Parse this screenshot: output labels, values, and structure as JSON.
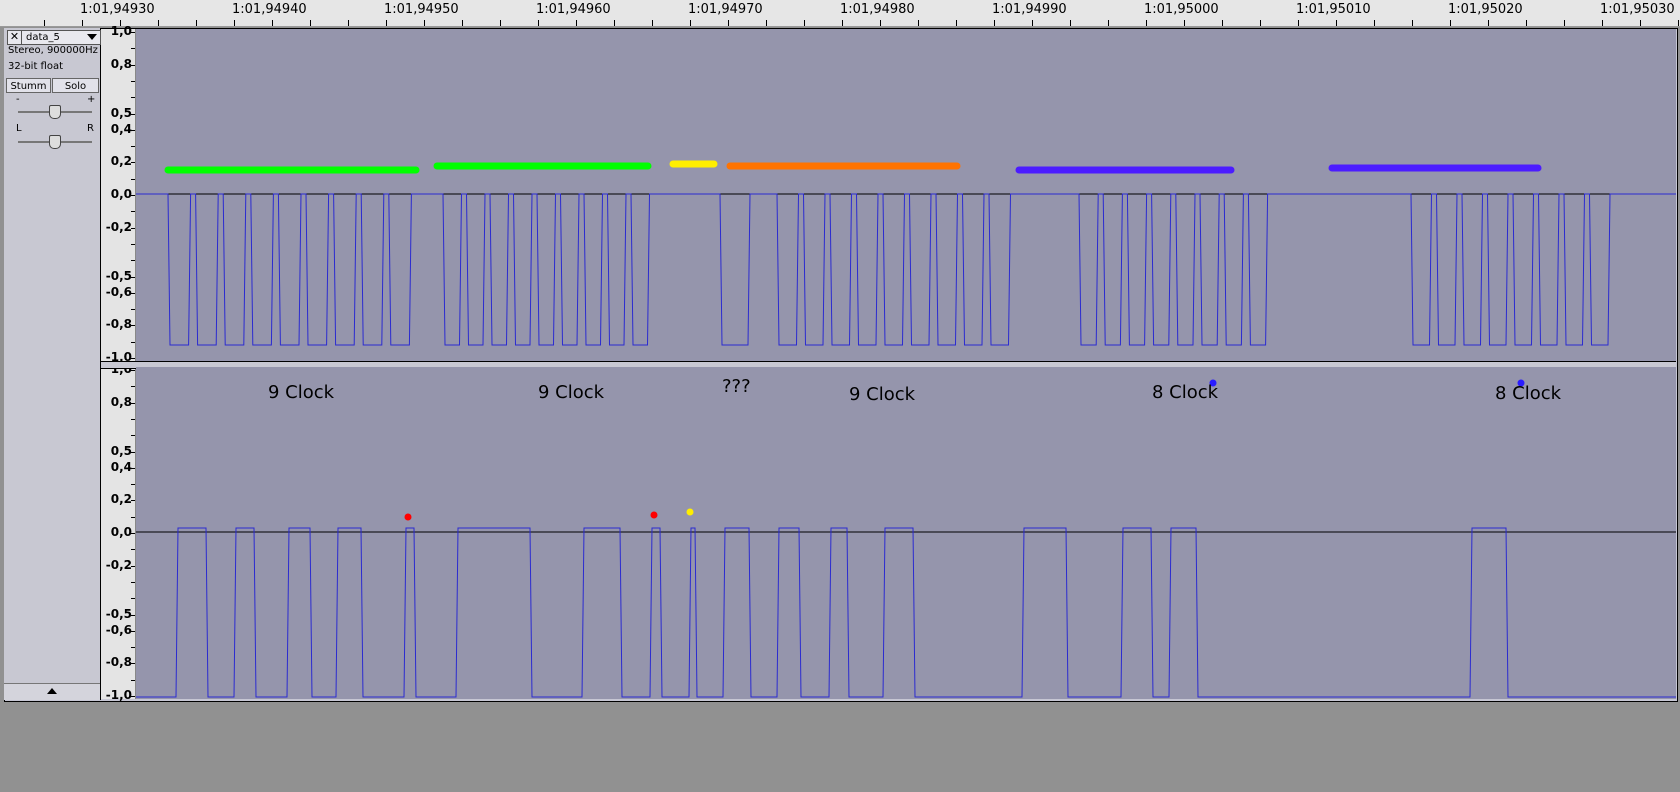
{
  "ruler": {
    "labels": [
      "1:01,94930",
      "1:01,94940",
      "1:01,94950",
      "1:01,94960",
      "1:01,94970",
      "1:01,94980",
      "1:01,94990",
      "1:01,95000",
      "1:01,95010",
      "1:01,95020",
      "1:01,95030"
    ]
  },
  "track": {
    "name": "data_5",
    "close_glyph": "✕",
    "format_line1": "Stereo, 900000Hz",
    "format_line2": "32-bit float",
    "mute_label": "Stumm",
    "solo_label": "Solo",
    "gain_minus": "-",
    "gain_plus": "+",
    "pan_left": "L",
    "pan_right": "R",
    "gain_level": 0.5,
    "pan_level": 0.5
  },
  "amplitude_scale": [
    "1,0",
    "0,8",
    "0,5",
    "0,4",
    "0,2",
    "0,0",
    "-0,2",
    "-0,5",
    "-0,6",
    "-0,8",
    "-1,0"
  ],
  "annotations": {
    "clock_1": "9 Clock",
    "clock_2": "9 Clock",
    "unknown": "???",
    "clock_3": "9 Clock",
    "clock_4": "8 Clock",
    "clock_5": "8 Clock"
  },
  "colors": {
    "waveform": "#2b2bd0",
    "background": "#9595ac",
    "marker_green": "#00ff00",
    "marker_yellow": "#ffee00",
    "marker_orange": "#ff7300",
    "marker_purple": "#4b1cff",
    "dot_red": "#ff0000",
    "dot_yellow": "#ffee00",
    "dot_blue": "#2a1cff"
  }
}
